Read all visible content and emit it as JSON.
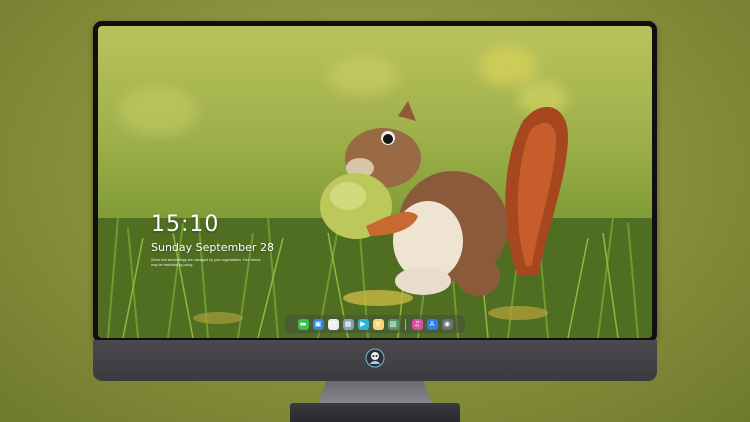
{
  "lock_screen": {
    "time": "15:10",
    "date": "Sunday September 28",
    "notice": "Some text and settings are managed by your organization. Your device may be restricted by policy."
  },
  "dock": {
    "apps": [
      {
        "name": "messages-icon",
        "glyph": "▬",
        "color": "#3fbf4a"
      },
      {
        "name": "finder-icon",
        "glyph": "▣",
        "color": "#2f86e0"
      },
      {
        "name": "clock-icon",
        "glyph": "◔",
        "color": "#eeeeee"
      },
      {
        "name": "preview-icon",
        "glyph": "▦",
        "color": "#8aa0b8"
      },
      {
        "name": "video-icon",
        "glyph": "▶",
        "color": "#2db3d6"
      },
      {
        "name": "notes-icon",
        "glyph": "≡",
        "color": "#f3d77a"
      },
      {
        "name": "photos-icon",
        "glyph": "▧",
        "color": "#5a9a6a"
      },
      {
        "name": "music-icon",
        "glyph": "♫",
        "color": "#d94f9f"
      },
      {
        "name": "app-store-icon",
        "glyph": "A",
        "color": "#2f7ee6"
      },
      {
        "name": "camera-icon",
        "glyph": "◉",
        "color": "#6c7078"
      }
    ]
  }
}
